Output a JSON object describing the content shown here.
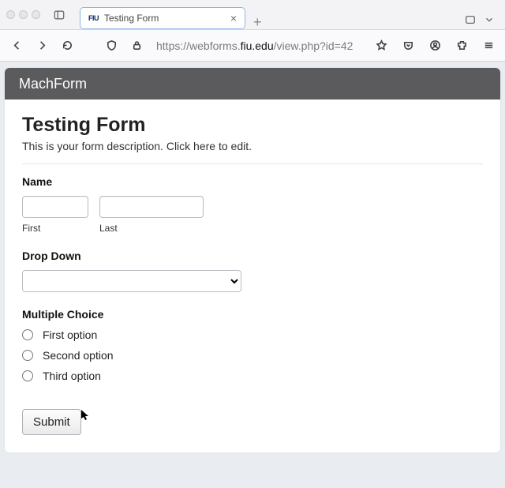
{
  "browser": {
    "tab": {
      "favicon": "FIU",
      "title": "Testing Form"
    },
    "url_prefix": "https://webforms.",
    "url_host": "fiu.edu",
    "url_suffix": "/view.php?id=42"
  },
  "brand": "MachForm",
  "form": {
    "title": "Testing Form",
    "description": "This is your form description. Click here to edit.",
    "name": {
      "label": "Name",
      "first_sub": "First",
      "last_sub": "Last",
      "first_value": "",
      "last_value": ""
    },
    "dropdown": {
      "label": "Drop Down",
      "value": ""
    },
    "multiple_choice": {
      "label": "Multiple Choice",
      "options": [
        {
          "label": "First option",
          "checked": false
        },
        {
          "label": "Second option",
          "checked": false
        },
        {
          "label": "Third option",
          "checked": false
        }
      ]
    },
    "submit_label": "Submit"
  }
}
